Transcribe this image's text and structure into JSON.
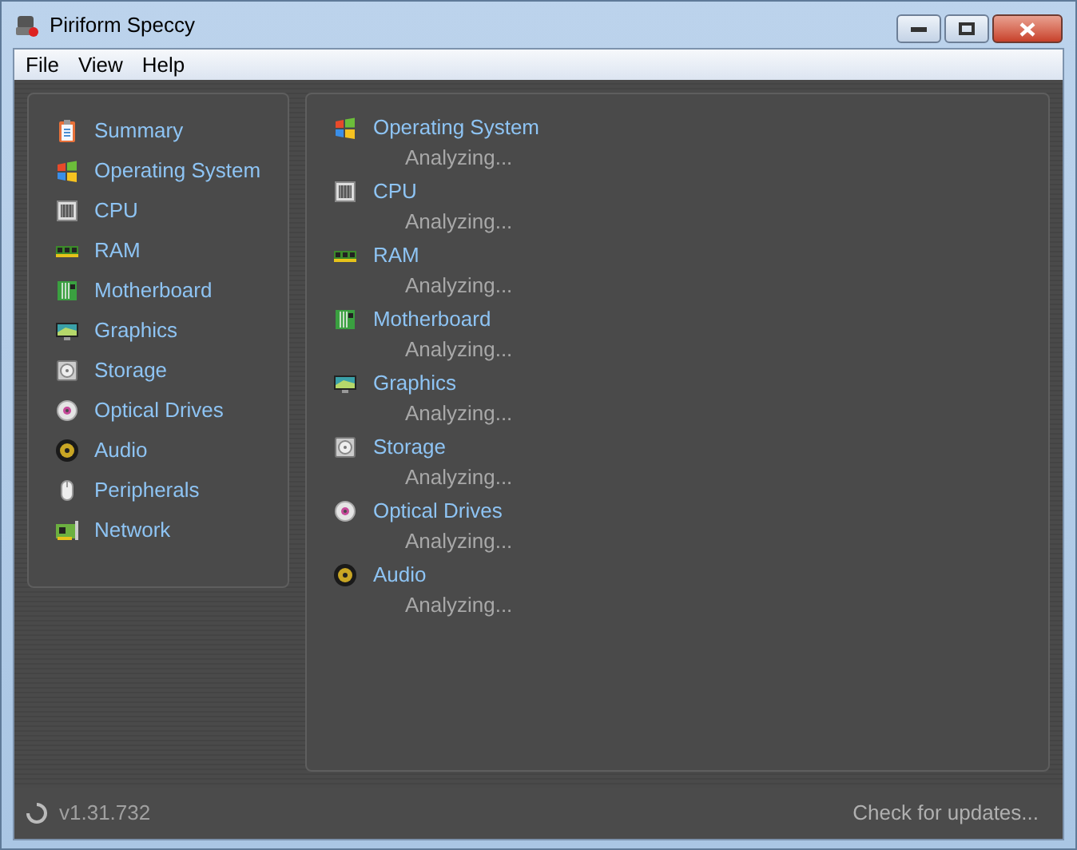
{
  "window": {
    "title": "Piriform Speccy"
  },
  "menu": [
    "File",
    "View",
    "Help"
  ],
  "sidebar": {
    "items": [
      {
        "label": "Summary",
        "kind": "summary"
      },
      {
        "label": "Operating System",
        "kind": "os"
      },
      {
        "label": "CPU",
        "kind": "cpu"
      },
      {
        "label": "RAM",
        "kind": "ram"
      },
      {
        "label": "Motherboard",
        "kind": "board"
      },
      {
        "label": "Graphics",
        "kind": "monitor"
      },
      {
        "label": "Storage",
        "kind": "disk"
      },
      {
        "label": "Optical Drives",
        "kind": "optical"
      },
      {
        "label": "Audio",
        "kind": "speaker"
      },
      {
        "label": "Peripherals",
        "kind": "mouse"
      },
      {
        "label": "Network",
        "kind": "network"
      }
    ]
  },
  "sections": [
    {
      "title": "Operating System",
      "kind": "os",
      "status": "Analyzing..."
    },
    {
      "title": "CPU",
      "kind": "cpu",
      "status": "Analyzing..."
    },
    {
      "title": "RAM",
      "kind": "ram",
      "status": "Analyzing..."
    },
    {
      "title": "Motherboard",
      "kind": "board",
      "status": "Analyzing..."
    },
    {
      "title": "Graphics",
      "kind": "monitor",
      "status": "Analyzing..."
    },
    {
      "title": "Storage",
      "kind": "disk",
      "status": "Analyzing..."
    },
    {
      "title": "Optical Drives",
      "kind": "optical",
      "status": "Analyzing..."
    },
    {
      "title": "Audio",
      "kind": "speaker",
      "status": "Analyzing..."
    }
  ],
  "status_bar": {
    "version": "v1.31.732",
    "link": "Check for updates..."
  }
}
